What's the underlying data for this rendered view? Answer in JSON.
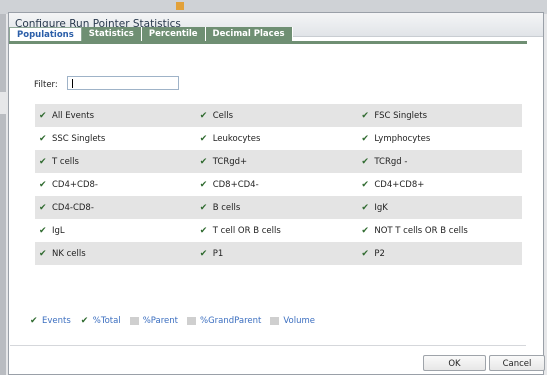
{
  "dialog": {
    "title": "Configure Run Pointer Statistics"
  },
  "tabs": [
    {
      "label": "Populations"
    },
    {
      "label": "Statistics"
    },
    {
      "label": "Percentile"
    },
    {
      "label": "Decimal Places"
    }
  ],
  "filter": {
    "label": "Filter:",
    "value": ""
  },
  "populations": [
    [
      {
        "label": "All Events"
      },
      {
        "label": "Cells"
      },
      {
        "label": "FSC Singlets"
      }
    ],
    [
      {
        "label": "SSC Singlets"
      },
      {
        "label": "Leukocytes"
      },
      {
        "label": "Lymphocytes"
      }
    ],
    [
      {
        "label": "T cells"
      },
      {
        "label": "TCRgd+"
      },
      {
        "label": "TCRgd -"
      }
    ],
    [
      {
        "label": "CD4+CD8-"
      },
      {
        "label": "CD8+CD4-"
      },
      {
        "label": "CD4+CD8+"
      }
    ],
    [
      {
        "label": "CD4-CD8-"
      },
      {
        "label": "B cells"
      },
      {
        "label": "IgK"
      }
    ],
    [
      {
        "label": "IgL"
      },
      {
        "label": "T cell OR B cells"
      },
      {
        "label": "NOT T cells OR B cells"
      }
    ],
    [
      {
        "label": "NK cells"
      },
      {
        "label": "P1"
      },
      {
        "label": "P2"
      }
    ]
  ],
  "stat_options": [
    {
      "label": "Events",
      "checked": true
    },
    {
      "label": "%Total",
      "checked": true
    },
    {
      "label": "%Parent",
      "checked": false
    },
    {
      "label": "%GrandParent",
      "checked": false
    },
    {
      "label": "Volume",
      "checked": false
    }
  ],
  "buttons": {
    "ok": "OK",
    "cancel": "Cancel"
  },
  "check_glyph": "✔",
  "colors": {
    "tab_green": "#6f8f73",
    "link_blue": "#3c6fc0"
  }
}
